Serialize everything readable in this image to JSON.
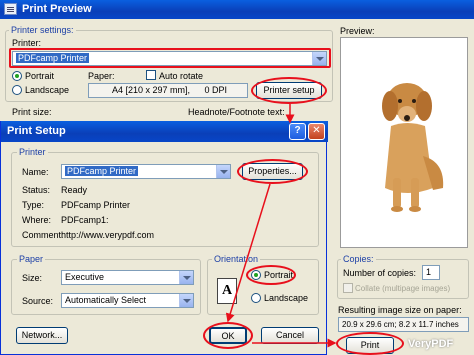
{
  "main_window": {
    "title": "Print Preview",
    "printer_settings_label": "Printer settings:",
    "printer_label": "Printer:",
    "printer_value": "PDFcamp Printer",
    "portrait": "Portrait",
    "landscape": "Landscape",
    "paper_label": "Paper:",
    "paper_value": "A4 [210 x 297 mm],",
    "dpi_value": "0 DPI",
    "auto_rotate": "Auto rotate",
    "printer_setup_button": "Printer setup",
    "print_size_label": "Print size:",
    "headnote_label": "Headnote/Footnote text:",
    "preview_label": "Preview:",
    "copies_group": "Copies:",
    "number_of_copies_label": "Number of copies:",
    "number_of_copies_value": "1",
    "collate": "Collate (multipage images)",
    "resulting_size_label": "Resulting image size on paper:",
    "resulting_size_value": "20.9 x 29.6 cm; 8.2 x 11.7 inches",
    "print_button": "Print",
    "watermark": "VeryPDF"
  },
  "dialog": {
    "title": "Print Setup",
    "printer_group": "Printer",
    "name_label": "Name:",
    "name_value": "PDFcamp Printer",
    "properties_button": "Properties...",
    "status_label": "Status:",
    "status_value": "Ready",
    "type_label": "Type:",
    "type_value": "PDFcamp Printer",
    "where_label": "Where:",
    "where_value": "PDFcamp1:",
    "comment_label": "Comment:",
    "comment_value": "http://www.verypdf.com",
    "paper_group": "Paper",
    "size_label": "Size:",
    "size_value": "Executive",
    "source_label": "Source:",
    "source_value": "Automatically Select",
    "orientation_group": "Orientation",
    "portrait": "Portrait",
    "landscape": "Landscape",
    "orientation_glyph": "A",
    "network_button": "Network...",
    "ok_button": "OK",
    "cancel_button": "Cancel",
    "help_button": "?",
    "close_button": "✕"
  },
  "colors": {
    "xp_title_blue": "#0a4fd0",
    "dialog_bg": "#ece9d8",
    "selection": "#316ac5",
    "annotation_red": "#e8101c"
  }
}
